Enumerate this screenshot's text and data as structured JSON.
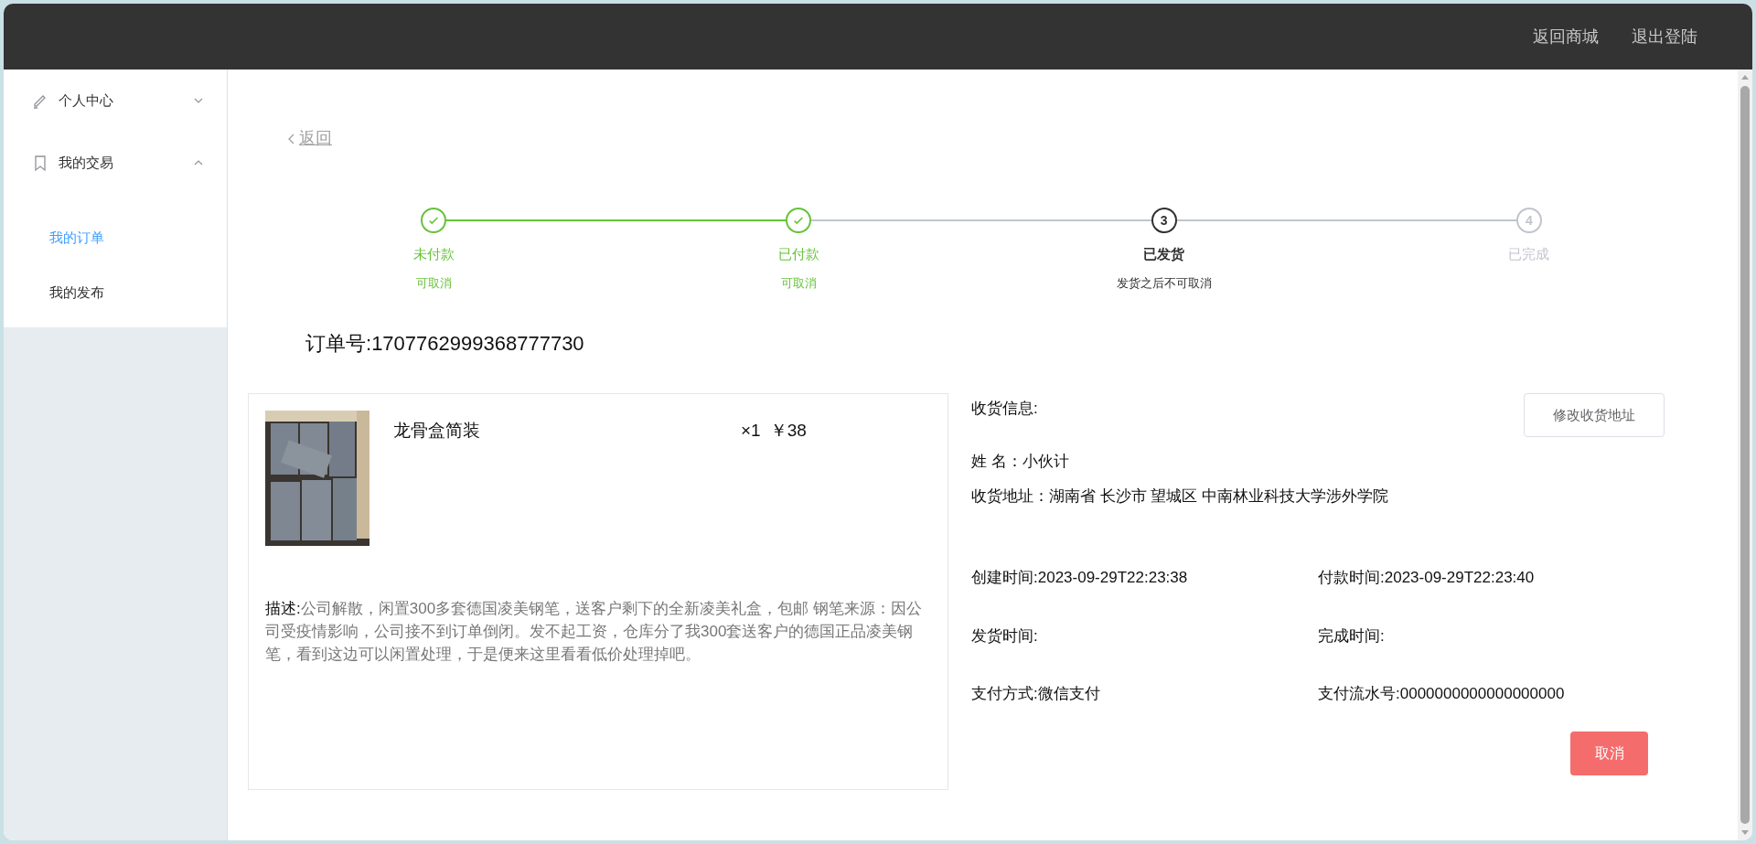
{
  "header": {
    "links": [
      "返回商城",
      "退出登陆"
    ]
  },
  "sidebar": {
    "groups": [
      {
        "label": "个人中心",
        "expanded": false
      },
      {
        "label": "我的交易",
        "expanded": true,
        "items": [
          {
            "label": "我的订单",
            "selected": true
          },
          {
            "label": "我的发布",
            "selected": false
          }
        ]
      }
    ]
  },
  "back_link": "返回",
  "steps": [
    {
      "title": "未付款",
      "description": "可取消",
      "kind": "done"
    },
    {
      "title": "已付款",
      "description": "可取消",
      "kind": "done"
    },
    {
      "number": "3",
      "title": "已发货",
      "description": "发货之后不可取消",
      "kind": "current"
    },
    {
      "number": "4",
      "title": "已完成",
      "kind": "pending"
    }
  ],
  "order_number": {
    "label": "订单号:",
    "value": "1707762999368777730"
  },
  "product": {
    "name": "龙骨盒简装",
    "quantity": "×1",
    "price": "￥38",
    "description_label": "描述:",
    "description": "公司解散，闲置300多套德国凌美钢笔，送客户剩下的全新凌美礼盒，包邮 钢笔来源：因公司受疫情影响，公司接不到订单倒闭。发不起工资，仓库分了我300套送客户的德国正品凌美钢笔，看到这边可以闲置处理，于是便来这里看看低价处理掉吧。"
  },
  "shipping": {
    "title": "收货信息:",
    "edit_button": "修改收货地址",
    "name": "姓 名：小伙计",
    "address": "收货地址：湖南省 长沙市 望城区 中南林业科技大学涉外学院"
  },
  "details": [
    {
      "label": "创建时间:",
      "value": "2023-09-29T22:23:38"
    },
    {
      "label": "付款时间:",
      "value": "2023-09-29T22:23:40"
    },
    {
      "label": "发货时间:"
    },
    {
      "label": "完成时间:"
    },
    {
      "label": "支付方式:",
      "value": "微信支付"
    },
    {
      "label": "支付流水号:",
      "value": "0000000000000000000"
    }
  ],
  "cancel_button": "取消"
}
